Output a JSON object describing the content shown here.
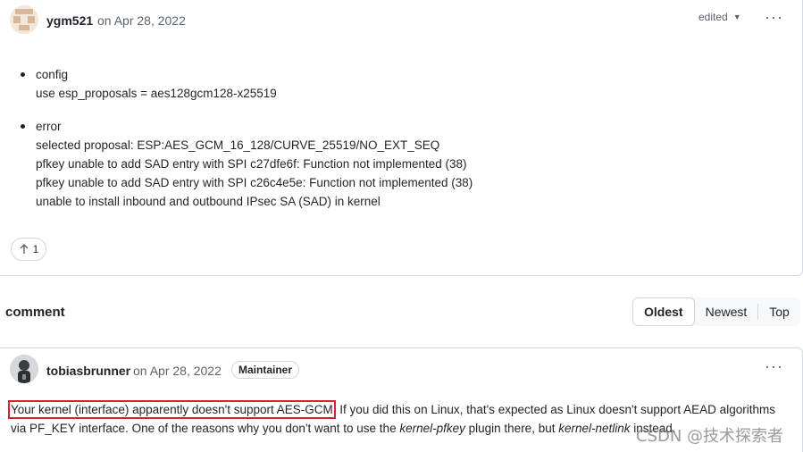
{
  "post": {
    "author": "ygm521",
    "date": "on Apr 28, 2022",
    "edited_label": "edited",
    "more": "···",
    "items": [
      {
        "title": "config",
        "lines": [
          "use esp_proposals = aes128gcm128-x25519"
        ]
      },
      {
        "title": "error",
        "lines": [
          "selected proposal: ESP:AES_GCM_16_128/CURVE_25519/NO_EXT_SEQ",
          "pfkey unable to add SAD entry with SPI c27dfe6f: Function not implemented (38)",
          "pfkey unable to add SAD entry with SPI c26c4e5e: Function not implemented (38)",
          "unable to install inbound and outbound IPsec SA (SAD) in kernel"
        ]
      }
    ],
    "reaction": {
      "icon": "arrow-up-icon",
      "count": "1"
    }
  },
  "section": {
    "title": "comment"
  },
  "sort": {
    "options": [
      "Oldest",
      "Newest",
      "Top"
    ],
    "selected": "Oldest"
  },
  "reply": {
    "author": "tobiasbrunner",
    "date": "on Apr 28, 2022",
    "badge": "Maintainer",
    "more": "···",
    "highlight": "Your kernel (interface) apparently doesn't support AES-GCM",
    "text_a": ". If you did this on Linux, that's expected as Linux doesn't support AEAD algorithms via PF_KEY interface. One of the reasons why you don't want to use the ",
    "plugin1": "kernel-pfkey",
    "text_b": " plugin there, but ",
    "plugin2": "kernel-netlink",
    "text_c": " instead."
  },
  "watermark": "CSDN @技术探索者",
  "colors": {
    "highlight_box": "#d9232d",
    "border": "#d0d7de",
    "muted": "#59636e"
  }
}
